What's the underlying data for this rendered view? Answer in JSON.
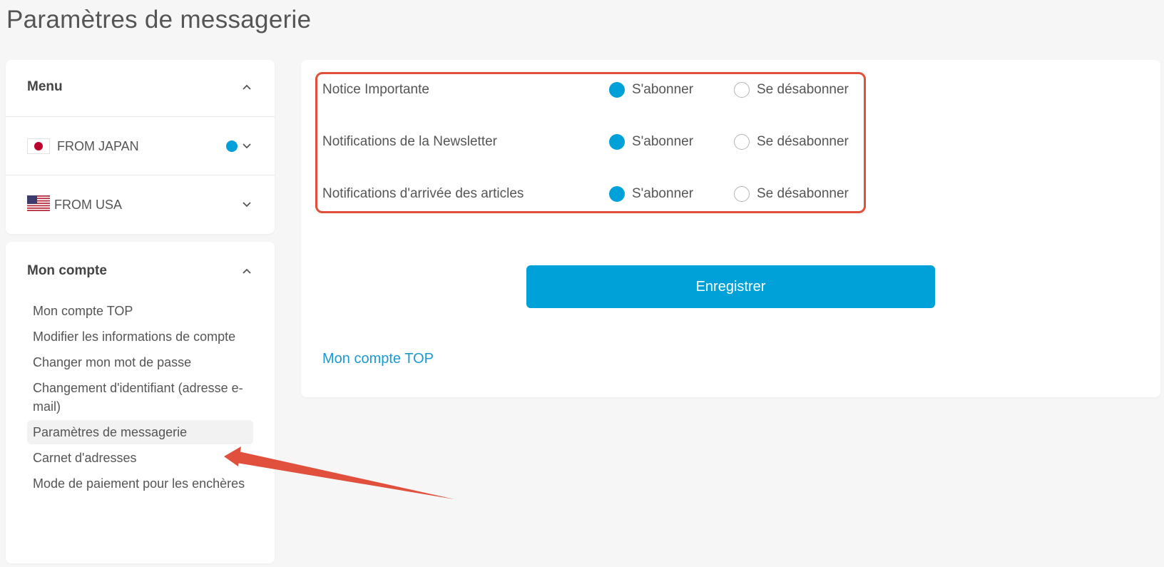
{
  "page": {
    "title": "Paramètres de messagerie"
  },
  "menu": {
    "heading": "Menu",
    "items": [
      {
        "label": "FROM JAPAN",
        "flag": "japan-flag-icon",
        "has_indicator": true
      },
      {
        "label": "FROM USA",
        "flag": "usa-flag-icon",
        "has_indicator": false
      }
    ]
  },
  "account": {
    "heading": "Mon compte",
    "links": [
      "Mon compte TOP",
      "Modifier les informations de compte",
      "Changer mon mot de passe",
      "Changement d'identifiant (adresse e-mail)",
      "Paramètres de messagerie",
      "Carnet d'adresses",
      "Mode de paiement pour les enchères"
    ],
    "active_link": "Paramètres de messagerie"
  },
  "preferences": {
    "options": {
      "subscribe": "S'abonner",
      "unsubscribe": "Se désabonner"
    },
    "rows": [
      {
        "label": "Notice Importante",
        "selected": "subscribe"
      },
      {
        "label": "Notifications de la Newsletter",
        "selected": "subscribe"
      },
      {
        "label": "Notifications d'arrivée des articles",
        "selected": "subscribe"
      }
    ]
  },
  "actions": {
    "save_label": "Enregistrer",
    "back_link": "Mon compte TOP"
  },
  "colors": {
    "accent": "#00a0d8",
    "annotation": "#e0503c",
    "flag_red": "#bc002d"
  }
}
